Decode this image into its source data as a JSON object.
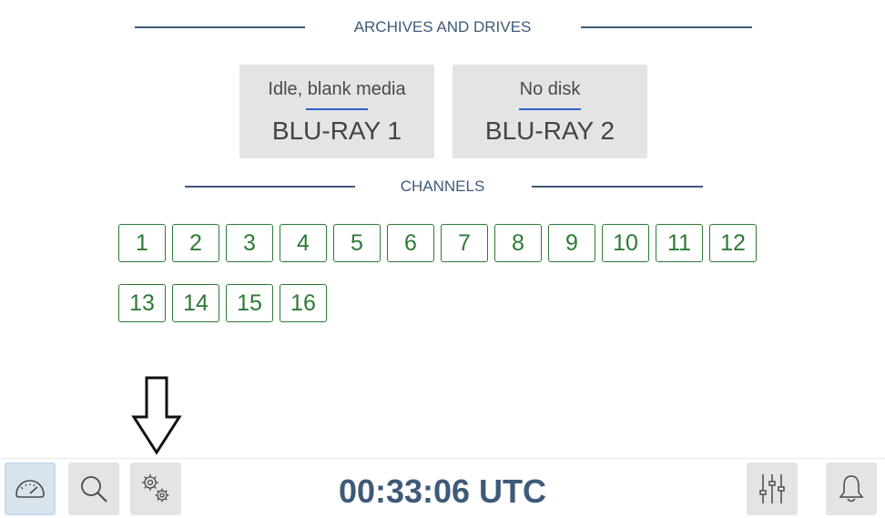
{
  "archives": {
    "header": "ARCHIVES AND DRIVES",
    "drives": [
      {
        "status": "Idle, blank media",
        "name": "BLU-RAY 1"
      },
      {
        "status": "No disk",
        "name": "BLU-RAY 2"
      }
    ]
  },
  "channels": {
    "header": "CHANNELS",
    "items": [
      "1",
      "2",
      "3",
      "4",
      "5",
      "6",
      "7",
      "8",
      "9",
      "10",
      "11",
      "12",
      "13",
      "14",
      "15",
      "16"
    ]
  },
  "bottom_bar": {
    "clock": "00:33:06 UTC",
    "buttons": [
      {
        "icon": "speedometer-icon",
        "active": true
      },
      {
        "icon": "search-icon",
        "active": false
      },
      {
        "icon": "gears-icon",
        "active": false
      },
      {
        "icon": "sliders-icon",
        "active": false
      },
      {
        "icon": "bell-icon",
        "active": false
      }
    ]
  },
  "colors": {
    "accent": "#3e5a78",
    "channel_green": "#2d7a35",
    "tile_bg": "#e4e4e4",
    "underline_blue": "#2f63c9"
  }
}
